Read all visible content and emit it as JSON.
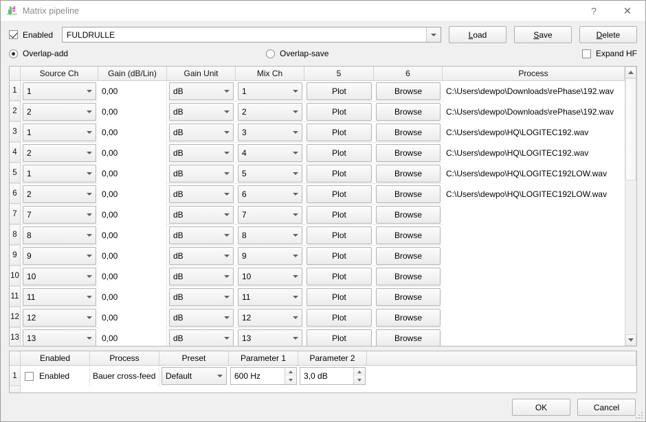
{
  "window": {
    "title": "Matrix pipeline",
    "icon": "waveform-plot-icon",
    "help_label": "?",
    "close_label": "✕"
  },
  "top": {
    "enabled_label": "Enabled",
    "enabled_checked": true,
    "preset_value": "FULDRULLE",
    "load_label_pre": "",
    "load_mnemonic": "L",
    "load_label_post": "oad",
    "save_mnemonic": "S",
    "save_label_post": "ave",
    "delete_mnemonic": "D",
    "delete_label_post": "elete",
    "overlap_add_label": "Overlap-add",
    "overlap_save_label": "Overlap-save",
    "overlap_selected": "Overlap-add",
    "expand_hf_label": "Expand HF",
    "expand_hf_checked": false
  },
  "matrix_table": {
    "headers": [
      "Source Ch",
      "Gain (dB/Lin)",
      "Gain Unit",
      "Mix Ch",
      "5",
      "6",
      "Process"
    ],
    "plot_label": "Plot",
    "browse_label": "Browse",
    "rows": [
      {
        "n": "1",
        "source": "1",
        "gain": "0,00",
        "unit": "dB",
        "mix": "1",
        "plot": "Plot",
        "browse": "Browse",
        "process": "C:\\Users\\dewpo\\Downloads\\rePhase\\192.wav"
      },
      {
        "n": "2",
        "source": "2",
        "gain": "0,00",
        "unit": "dB",
        "mix": "2",
        "plot": "Plot",
        "browse": "Browse",
        "process": "C:\\Users\\dewpo\\Downloads\\rePhase\\192.wav"
      },
      {
        "n": "3",
        "source": "1",
        "gain": "0,00",
        "unit": "dB",
        "mix": "3",
        "plot": "Plot",
        "browse": "Browse",
        "process": "C:\\Users\\dewpo\\HQ\\LOGITEC192.wav"
      },
      {
        "n": "4",
        "source": "2",
        "gain": "0,00",
        "unit": "dB",
        "mix": "4",
        "plot": "Plot",
        "browse": "Browse",
        "process": "C:\\Users\\dewpo\\HQ\\LOGITEC192.wav"
      },
      {
        "n": "5",
        "source": "1",
        "gain": "0,00",
        "unit": "dB",
        "mix": "5",
        "plot": "Plot",
        "browse": "Browse",
        "process": "C:\\Users\\dewpo\\HQ\\LOGITEC192LOW.wav"
      },
      {
        "n": "6",
        "source": "2",
        "gain": "0,00",
        "unit": "dB",
        "mix": "6",
        "plot": "Plot",
        "browse": "Browse",
        "process": "C:\\Users\\dewpo\\HQ\\LOGITEC192LOW.wav"
      },
      {
        "n": "7",
        "source": "7",
        "gain": "0,00",
        "unit": "dB",
        "mix": "7",
        "plot": "Plot",
        "browse": "Browse",
        "process": ""
      },
      {
        "n": "8",
        "source": "8",
        "gain": "0,00",
        "unit": "dB",
        "mix": "8",
        "plot": "Plot",
        "browse": "Browse",
        "process": ""
      },
      {
        "n": "9",
        "source": "9",
        "gain": "0,00",
        "unit": "dB",
        "mix": "9",
        "plot": "Plot",
        "browse": "Browse",
        "process": ""
      },
      {
        "n": "10",
        "source": "10",
        "gain": "0,00",
        "unit": "dB",
        "mix": "10",
        "plot": "Plot",
        "browse": "Browse",
        "process": ""
      },
      {
        "n": "11",
        "source": "11",
        "gain": "0,00",
        "unit": "dB",
        "mix": "11",
        "plot": "Plot",
        "browse": "Browse",
        "process": ""
      },
      {
        "n": "12",
        "source": "12",
        "gain": "0,00",
        "unit": "dB",
        "mix": "12",
        "plot": "Plot",
        "browse": "Browse",
        "process": ""
      },
      {
        "n": "13",
        "source": "13",
        "gain": "0,00",
        "unit": "dB",
        "mix": "13",
        "plot": "Plot",
        "browse": "Browse",
        "process": ""
      }
    ],
    "scrollbar": {
      "thumb_percent": 40
    }
  },
  "process_table": {
    "headers": [
      "Enabled",
      "Process",
      "Preset",
      "Parameter 1",
      "Parameter 2"
    ],
    "rows": [
      {
        "n": "1",
        "enabled_label": "Enabled",
        "enabled_checked": false,
        "process": "Bauer cross-feed",
        "preset": "Default",
        "param1": "600 Hz",
        "param2": "3,0 dB"
      }
    ]
  },
  "footer": {
    "ok_label": "OK",
    "cancel_label": "Cancel"
  }
}
